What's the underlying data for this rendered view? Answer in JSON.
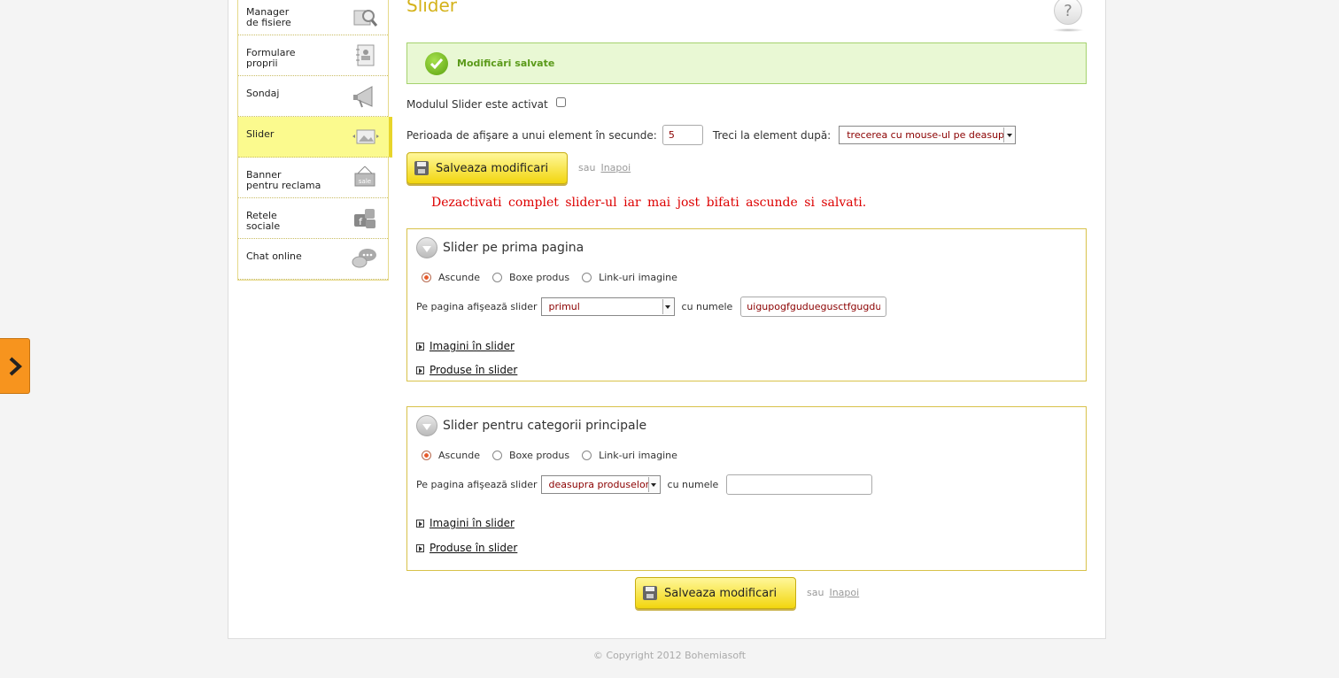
{
  "page": {
    "title": "Slider"
  },
  "sidebar": {
    "items": [
      {
        "label": "Manager\nde fisiere",
        "icon": "file-manager-icon"
      },
      {
        "label": "Formulare\nproprii",
        "icon": "forms-icon"
      },
      {
        "label": "Sondaj",
        "icon": "megaphone-icon"
      },
      {
        "label": "Slider",
        "icon": "image-slider-icon",
        "active": true
      },
      {
        "label": "Banner\npentru reclama",
        "icon": "sale-banner-icon"
      },
      {
        "label": "Retele\nsociale",
        "icon": "social-networks-icon"
      },
      {
        "label": "Chat online",
        "icon": "chat-icon"
      }
    ]
  },
  "message": {
    "text": "Modificări salvate"
  },
  "settings": {
    "module_label": "Modulul Slider este activat",
    "period_label": "Perioada de afişare a unui element în secunde:",
    "period_value": "5",
    "next_label": "Treci la element după:",
    "next_value": "trecerea cu mouse-ul pe deasupra"
  },
  "actions": {
    "save_label": "Salveaza modificari",
    "or_label": "sau",
    "back_label": "Inapoi"
  },
  "warning": "Dezactivati complet slider-ul iar mai jost bifati ascunde si salvati.",
  "boxes": [
    {
      "title": "Slider pe prima pagina",
      "options": [
        "Ascunde",
        "Boxe produs",
        "Link-uri imagine"
      ],
      "page_label": "Pe pagina afişează slider",
      "page_value": "primul",
      "name_label": "cu numele",
      "name_value": "uigupogfguduegusctfgugdu",
      "link1": "Imagini în slider",
      "link2": "Produse în slider"
    },
    {
      "title": "Slider pentru categorii principale",
      "options": [
        "Ascunde",
        "Boxe produs",
        "Link-uri imagine"
      ],
      "page_label": "Pe pagina afişează slider",
      "page_value": "deasupra produselor",
      "name_label": "cu numele",
      "name_value": "",
      "link1": "Imagini în slider",
      "link2": "Produse în slider"
    }
  ],
  "footer": "© Copyright 2012 Bohemiasoft",
  "colors": {
    "accent": "#d4b21a",
    "button": "#f2d60f",
    "success": "#5b9a1a",
    "warning": "#dd0000",
    "tab": "#f7941e"
  }
}
